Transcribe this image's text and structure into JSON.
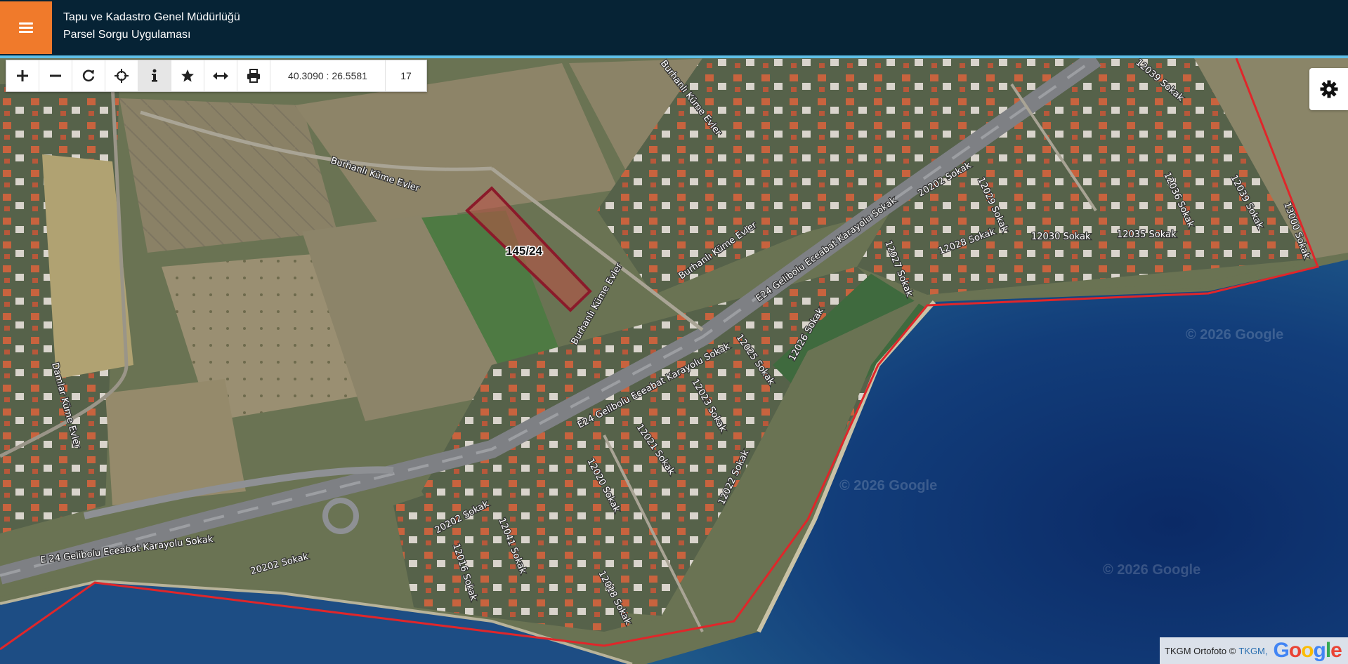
{
  "header": {
    "title_line1": "Tapu ve Kadastro Genel Müdürlüğü",
    "title_line2": "Parsel Sorgu Uygulaması",
    "menu_icon": "hamburger-icon",
    "accent_color": "#f07a2b",
    "bg_color": "#062335"
  },
  "toolbar": {
    "buttons": [
      {
        "name": "zoom-in",
        "icon": "plus-icon"
      },
      {
        "name": "zoom-out",
        "icon": "minus-icon"
      },
      {
        "name": "refresh",
        "icon": "refresh-icon"
      },
      {
        "name": "locate",
        "icon": "crosshair-icon"
      },
      {
        "name": "info",
        "icon": "info-icon",
        "active": true
      },
      {
        "name": "favorites",
        "icon": "star-icon"
      },
      {
        "name": "measure",
        "icon": "arrows-horizontal-icon"
      },
      {
        "name": "print",
        "icon": "print-icon"
      }
    ],
    "coordinates": "40.3090 : 26.5581",
    "zoom_level": "17"
  },
  "map": {
    "parcel_label": "145/24",
    "streets": [
      "Burhanlı Küme Evler",
      "Burhanlı Küme Evler",
      "Burhanlı Küme Evler",
      "Burhanlı Küme Evler",
      "E24 Gelibolu Eceabat Karayolu Sokak",
      "E24 Gelibolu Eceabat Karayolu Sokak",
      "E 24 Gelibolu Eceabat Karayolu Sokak",
      "Damlar Küme Evler",
      "20202 Sokak",
      "20202 Sokak",
      "20202 Sokak",
      "12039 Sokak",
      "12036 Sokak",
      "12039 Sokak",
      "13000 Sokak",
      "12035 Sokak",
      "12030 Sokak",
      "12029 Sokak",
      "12028 Sokak",
      "12027 Sokak",
      "12025 Sokak",
      "12026 Sokak",
      "12023 Sokak",
      "12021 Sokak",
      "12020 Sokak",
      "12022 Sokak",
      "12041 Sokak",
      "12016 Sokak",
      "12018 Sokak"
    ],
    "watermarks": [
      "© 2026 Google",
      "© 2026 Google",
      "© 2026 Google"
    ],
    "boundary_color": "#e0262a",
    "parcel_color": "#8b1a2a"
  },
  "settings": {
    "icon": "gear-icon"
  },
  "attribution": {
    "prefix": "TKGM Ortofoto ©",
    "link": "TKGM,",
    "google_letters": [
      "G",
      "o",
      "o",
      "g",
      "l",
      "e"
    ]
  }
}
